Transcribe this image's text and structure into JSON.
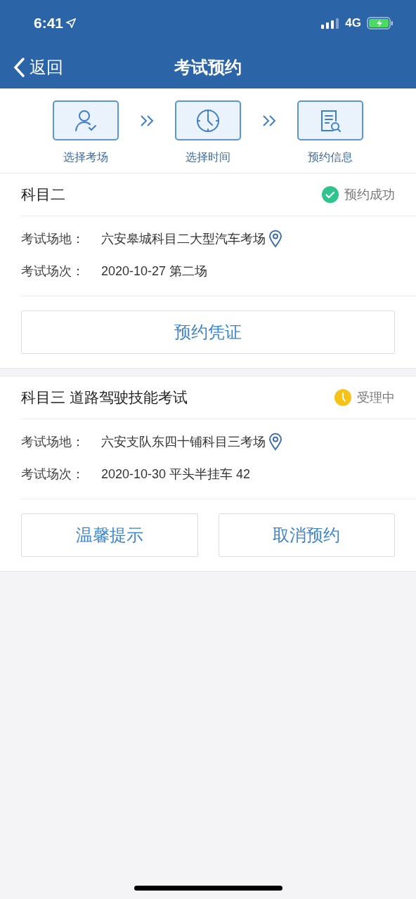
{
  "status_bar": {
    "time": "6:41",
    "network": "4G"
  },
  "nav": {
    "back": "返回",
    "title": "考试预约"
  },
  "steps": [
    {
      "kind": "person",
      "label": "选择考场"
    },
    {
      "kind": "clock",
      "label": "选择时间"
    },
    {
      "kind": "document",
      "label": "预约信息"
    }
  ],
  "bookings": [
    {
      "subject": "科目二",
      "status": {
        "kind": "success",
        "label": "预约成功"
      },
      "rows": [
        {
          "label": "考试场地：",
          "value": "六安皋城科目二大型汽车考场",
          "location": true
        },
        {
          "label": "考试场次：",
          "value": "2020-10-27 第二场",
          "location": false
        }
      ],
      "buttons": [
        "预约凭证"
      ]
    },
    {
      "subject": "科目三 道路驾驶技能考试",
      "status": {
        "kind": "processing",
        "label": "受理中"
      },
      "rows": [
        {
          "label": "考试场地：",
          "value": "六安支队东四十铺科目三考场",
          "location": true
        },
        {
          "label": "考试场次：",
          "value": "2020-10-30 平头半挂车 42",
          "location": false
        }
      ],
      "buttons": [
        "温馨提示",
        "取消预约"
      ]
    }
  ]
}
